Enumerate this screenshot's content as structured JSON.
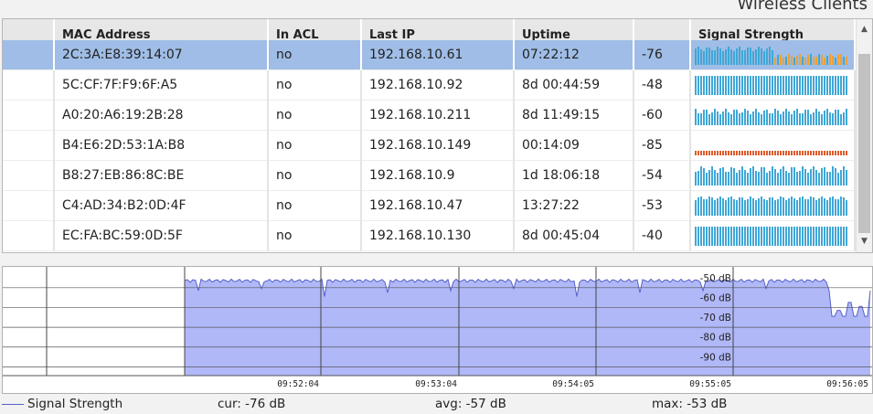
{
  "window": {
    "title": "Wireless Clients"
  },
  "table": {
    "columns": [
      "",
      "MAC Address",
      "In ACL",
      "Last IP",
      "Uptime",
      "",
      "Signal Strength"
    ],
    "rows": [
      {
        "mac": "2C:3A:E8:39:14:07",
        "acl": "no",
        "ip": "192.168.10.61",
        "uptime": "07:22:12",
        "signal": "-76",
        "selected": true,
        "bars": "mixed"
      },
      {
        "mac": "5C:CF:7F:F9:6F:A5",
        "acl": "no",
        "ip": "192.168.10.92",
        "uptime": "8d 00:44:59",
        "signal": "-48",
        "selected": false,
        "bars": "full"
      },
      {
        "mac": "A0:20:A6:19:2B:28",
        "acl": "no",
        "ip": "192.168.10.211",
        "uptime": "8d 11:49:15",
        "signal": "-60",
        "selected": false,
        "bars": "medium"
      },
      {
        "mac": "B4:E6:2D:53:1A:B8",
        "acl": "no",
        "ip": "192.168.10.149",
        "uptime": "00:14:09",
        "signal": "-85",
        "selected": false,
        "bars": "low"
      },
      {
        "mac": "B8:27:EB:86:8C:BE",
        "acl": "no",
        "ip": "192.168.10.9",
        "uptime": "1d 18:06:18",
        "signal": "-54",
        "selected": false,
        "bars": "varied"
      },
      {
        "mac": "C4:AD:34:B2:0D:4F",
        "acl": "no",
        "ip": "192.168.10.47",
        "uptime": "13:27:22",
        "signal": "-53",
        "selected": false,
        "bars": "high"
      },
      {
        "mac": "EC:FA:BC:59:0D:5F",
        "acl": "no",
        "ip": "192.168.10.130",
        "uptime": "8d 00:45:04",
        "signal": "-40",
        "selected": false,
        "bars": "full"
      }
    ]
  },
  "colors": {
    "bar_good": "#3fa7d6",
    "bar_warn": "#f0a030",
    "bar_bad": "#e05a2a",
    "selection": "#9fbde6",
    "chart_fill": "#b0b8f8",
    "chart_line": "#5560c8"
  },
  "chart_data": {
    "type": "area",
    "y_tick_labels": [
      "-50 dB",
      "-60 dB",
      "-70 dB",
      "-80 dB",
      "-90 dB"
    ],
    "ylim": [
      -100,
      -45
    ],
    "x_tick_labels": [
      "09:52:04",
      "09:53:04",
      "09:54:05",
      "09:55:05",
      "09:56:05"
    ],
    "series": [
      {
        "name": "Signal Strength",
        "level": -52,
        "dips": [
          -56,
          -57,
          -58,
          -60
        ],
        "end_values": [
          -57,
          -70,
          -67,
          -70,
          -63,
          -70,
          -65,
          -70
        ]
      }
    ]
  },
  "legend": {
    "series_name": "Signal Strength",
    "cur": "cur: -76 dB",
    "avg": "avg: -57 dB",
    "max": "max: -53 dB"
  }
}
